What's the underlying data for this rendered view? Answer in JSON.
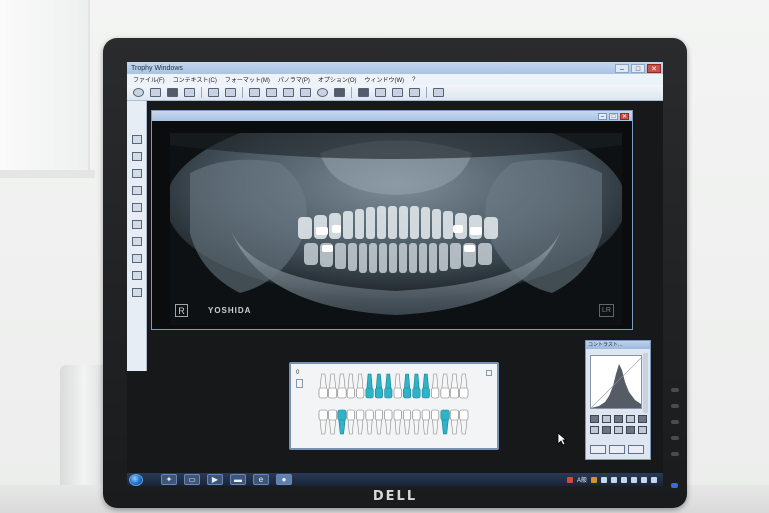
{
  "monitor": {
    "brand": "DELL"
  },
  "app": {
    "title": "Trophy Windows",
    "window_controls": {
      "minimize": "–",
      "maximize": "□",
      "close": "✕"
    },
    "menu": [
      "ファイル(F)",
      "コンテキスト(C)",
      "フォーマット(M)",
      "パノラマ(P)",
      "オプション(O)",
      "ウィンドウ(W)",
      "?"
    ]
  },
  "xray": {
    "orientation_marker": "R",
    "brand": "YOSHIDA",
    "corner_marker": "LR"
  },
  "dental_chart": {
    "side_label": "0",
    "teeth_per_row": 16,
    "highlighted_upper": [
      5,
      6,
      7,
      9,
      10,
      11
    ],
    "highlighted_lower": [
      2,
      13
    ],
    "highlight_color": "#2fb3c8"
  },
  "histogram": {
    "title": "コントラスト…"
  },
  "taskbar": {
    "tray_text": "A般"
  },
  "colors": {
    "monitor_bezel": "#1f2022",
    "screen_desktop": "#d8e4f1",
    "workspace": "#16181a",
    "window_frame": "#7f9bc1"
  }
}
